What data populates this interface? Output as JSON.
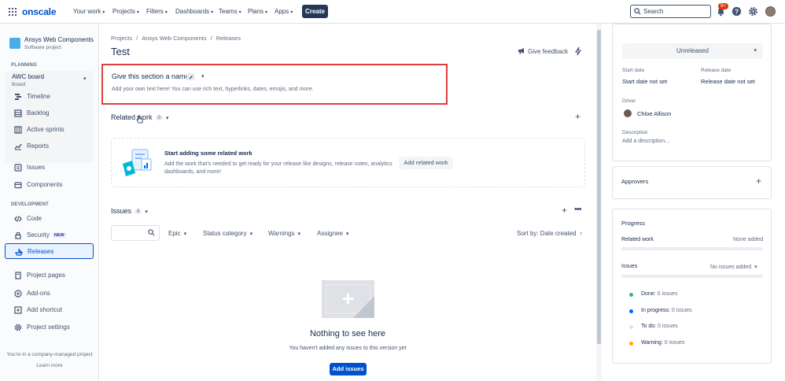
{
  "topnav": {
    "logo": "onscale",
    "items": [
      "Your work",
      "Projects",
      "Filters",
      "Dashboards",
      "Teams",
      "Plans",
      "Apps"
    ],
    "create_label": "Create",
    "search_placeholder": "Search",
    "notif_badge": "9+"
  },
  "sidebar": {
    "project_name": "Ansys Web Components",
    "project_type": "Software project",
    "planning_label": "PLANNING",
    "board_title": "AWC board",
    "board_sub": "Board",
    "board_items": [
      "Timeline",
      "Backlog",
      "Active sprints",
      "Reports"
    ],
    "items_mid": [
      "Issues",
      "Components"
    ],
    "development_label": "DEVELOPMENT",
    "dev_items": [
      "Code",
      "Security",
      "Releases"
    ],
    "security_badge": "NEW",
    "bottom_items": [
      "Project pages",
      "Add-ons",
      "Add shortcut",
      "Project settings"
    ],
    "footer_line1": "You're in a company-managed project",
    "footer_link": "Learn more"
  },
  "main": {
    "breadcrumb": [
      "Projects",
      "Ansys Web Components",
      "Releases"
    ],
    "title": "Test",
    "feedback_label": "Give feedback",
    "section_name": "Give this section a name",
    "section_desc": "Add your own text here! You can use rich text, hyperlinks, dates, emojis, and more.",
    "related_label": "Related work",
    "related_count": "0",
    "related_empty_title": "Start adding some related work",
    "related_empty_desc": "Add the work that's needed to get ready for your release like designs, release notes, analytics dashboards, and more!",
    "add_related_label": "Add related work",
    "issues_label": "Issues",
    "issues_count": "0",
    "filters": [
      "Epic",
      "Status category",
      "Warnings",
      "Assignee"
    ],
    "sort_label": "Sort by: Date created",
    "empty_title": "Nothing to see here",
    "empty_desc": "You haven't added any issues to this version yet",
    "add_issues_label": "Add issues"
  },
  "rpanel": {
    "status": "Unreleased",
    "start_date_label": "Start date",
    "start_date_value": "Start date not set",
    "release_date_label": "Release date",
    "release_date_value": "Release date not set",
    "driver_label": "Driver",
    "driver_name": "Chloe Allison",
    "description_label": "Description",
    "description_placeholder": "Add a description...",
    "approvers_label": "Approvers",
    "progress_label": "Progress",
    "related_work_label": "Related work",
    "related_work_value": "None added",
    "issues_label": "Issues",
    "issues_value": "No issues added",
    "legend": [
      {
        "label": "Done:",
        "value": "0 issues",
        "color": "#36b37e"
      },
      {
        "label": "In progress:",
        "value": "0 issues",
        "color": "#0065ff"
      },
      {
        "label": "To do:",
        "value": "0 issues",
        "color": "#dfe1e6"
      },
      {
        "label": "Warning:",
        "value": "0 issues",
        "color": "#ffab00"
      }
    ]
  }
}
